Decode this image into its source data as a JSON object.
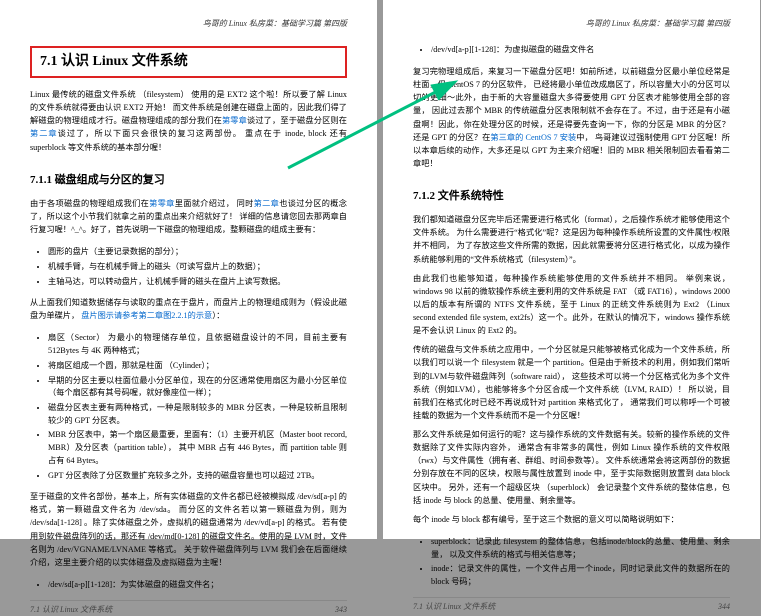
{
  "header": "鸟哥的 Linux 私房菜：基础学习篇 第四版",
  "footer_left": "7.1 认识 Linux 文件系统",
  "page_numbers": [
    "343",
    "344"
  ],
  "left": {
    "h1": "7.1 认识 Linux 文件系统",
    "p1_a": "Linux 最传统的磁盘文件系统 （filesystem） 使用的是 EXT2 这个啦！所以要了解 Linux 的文件系统就得要由认识 EXT2 开始！ 而文件系统是创建在磁盘上面的，因此我们得了解磁盘的物理组成才行。磁盘物理组成的部分我们在",
    "p1_link1": "第零章",
    "p1_b": "谈过了，至于磁盘分区则在",
    "p1_link2": "第二章",
    "p1_c": "谈过了，所以下面只会很快的复习这两部份。 重点在于 inode, block 还有 superblock 等文件系统的基本部分喔！",
    "h2": "7.1.1 磁盘组成与分区的复习",
    "p2_a": "由于各项磁盘的物理组成我们在",
    "p2_link1": "第零章",
    "p2_b": "里面就介绍过， 同时",
    "p2_link2": "第二章",
    "p2_c": "也谈过分区的概念了，所以这个小节我们就拿之前的重点出来介绍就好了！ 详细的信息请您回去那两章自行复习喔！^_^。好了，首先说明一下磁盘的物理组成，整颗磁盘的组成主要有：",
    "ul1": [
      "圆形的盘片（主要记录数据的部分）；",
      "机械手臂，与在机械手臂上的磁头（可读写盘片上的数据）；",
      "主轴马达，可以转动盘片，让机械手臂的磁头在盘片上读写数据。"
    ],
    "p3_a": "从上面我们知道数据储存与读取的重点在于盘片，而盘片上的物理组成则为（假设此磁盘为单碟片， ",
    "p3_link": "盘片图示请参考第二章图2.2.1的示意",
    "p3_b": "）：",
    "ul2": [
      "扇区（Sector） 为最小的物理储存单位，且依据磁盘设计的不同，目前主要有 512Bytes 与 4K 两种格式；",
      "将扇区组成一个圆，那就是柱面 （Cylinder）；",
      "早期的分区主要以柱面位最小分区单位，现在的分区通常使用扇区为最小分区单位（每个扇区都有其号码喔，就好像座位一样）；",
      "磁盘分区表主要有两种格式，一种是限制较多的 MBR 分区表，一种是较新且限制较少的 GPT 分区表。",
      "MBR 分区表中，第一个扇区最重要，里面有：（1）主要开机区（Master boot record, MBR）及分区表（partition table）， 其中 MBR 占有 446 Bytes，而 partition table 则占有 64 Bytes。",
      "GPT 分区表除了分区数量扩充较多之外，支持的磁盘容量也可以超过 2TB。"
    ],
    "p4": "至于磁盘的文件名部份，基本上，所有实体磁盘的文件名都已经被模拟成 /dev/sd[a-p] 的格式，第一颗磁盘文件名为 /dev/sda。 而分区的文件名若以第一颗磁盘为例，则为 /dev/sda[1-128] 。除了实体磁盘之外，虚拟机的磁盘通常为 /dev/vd[a-p] 的格式。 若有使用到软件磁盘阵列的话，那还有 /dev/md[0-128] 的磁盘文件名。使用的是 LVM 时，文件名则为 /dev/VGNAME/LVNAME 等格式。 关于软件磁盘阵列与 LVM 我们会在后面继续介绍，这里主要介绍的以实体磁盘及虚拟磁盘为主喔！",
    "ul3": [
      "/dev/sd[a-p][1-128]：为实体磁盘的磁盘文件名；"
    ]
  },
  "right": {
    "ul0": [
      "/dev/vd[a-p][1-128]：为虚拟磁盘的磁盘文件名"
    ],
    "p1_a": "复习完物理组成后，来复习一下磁盘分区吧！如前所述，以前磁盘分区最小单位经常是柱面，但 CentOS 7 的分区软件， 已经将最小单位改成扇区了，所以容量大小的分区可以切的更细～此外，由于新的大容量磁盘大多得要使用 GPT 分区表才能够使用全部的容量， 因此过去那个 MBR 的传统磁盘分区表限制就不会存在了。不过，由于还是有小磁盘啊！因此，你在处理分区的时候，还是得要先查询一下，你的分区是 MBR 的分区？还是 GPT 的分区？在",
    "p1_link1": "第三章的 CentOS 7 安装",
    "p1_b": "中， 鸟哥建议过强制使用 GPT 分区喔！所以本章后续的动作，大多还是以 GPT 为主来介绍喔！旧的 MBR 相关限制回去看看第二章吧！",
    "h2": "7.1.2 文件系统特性",
    "p2": "我们都知道磁盘分区完毕后还需要进行格式化（format），之后操作系统才能够使用这个文件系统。 为什么需要进行“格式化”呢？这是因为每种操作系统所设置的文件属性/权限并不相同， 为了存放这些文件所需的数据，因此就需要将分区进行格式化，以成为操作系统能够利用的“文件系统格式（filesystem）”。",
    "p3": "由此我们也能够知道，每种操作系统能够使用的文件系统并不相同。 举例来说，windows 98 以前的微软操作系统主要利用的文件系统是 FAT （或 FAT16），windows 2000 以后的版本有所谓的 NTFS 文件系统，至于 Linux 的正统文件系统则为 Ext2 （Linux second extended file system, ext2fs）这一个。此外，在默认的情况下，windows 操作系统是不会认识 Linux 的 Ext2 的。",
    "p4": "传统的磁盘与文件系统之应用中，一个分区就是只能够被格式化成为一个文件系统，所以我们可以说一个 filesystem 就是一个 partition。但是由于新技术的利用，例如我们常听到的LVM与软件磁盘阵列（software raid）， 这些技术可以将一个分区格式化为多个文件系统（例如LVM），也能够将多个分区合成一个文件系统（LVM, RAID）！ 所以说，目前我们在格式化时已经不再说成针对 partition 来格式化了， 通常我们可以称呼一个可被挂载的数据为一个文件系统而不是一个分区喔！",
    "p5": "那么文件系统是如何运行的呢？这与操作系统的文件数据有关。较新的操作系统的文件数据除了文件实际内容外， 通常含有非常多的属性，例如 Linux 操作系统的文件权限（rwx）与文件属性（拥有者、群组、时间参数等）。 文件系统通常会将这两部份的数据分别存放在不同的区块，权限与属性放置到 inode 中，至于实际数据则放置到 data block 区块中。 另外，还有一个超级区块 （superblock） 会记录整个文件系统的整体信息，包括 inode 与 block 的总量、使用量、剩余量等。",
    "p6": "每个 inode 与 block 都有编号，至于这三个数据的意义可以简略说明如下：",
    "ul1": [
      "superblock：记录此 filesystem 的整体信息，包括inode/block的总量、使用量、剩余量， 以及文件系统的格式与相关信息等；",
      "inode：记录文件的属性，一个文件占用一个inode，同时记录此文件的数据所在的 block 号码；"
    ]
  }
}
